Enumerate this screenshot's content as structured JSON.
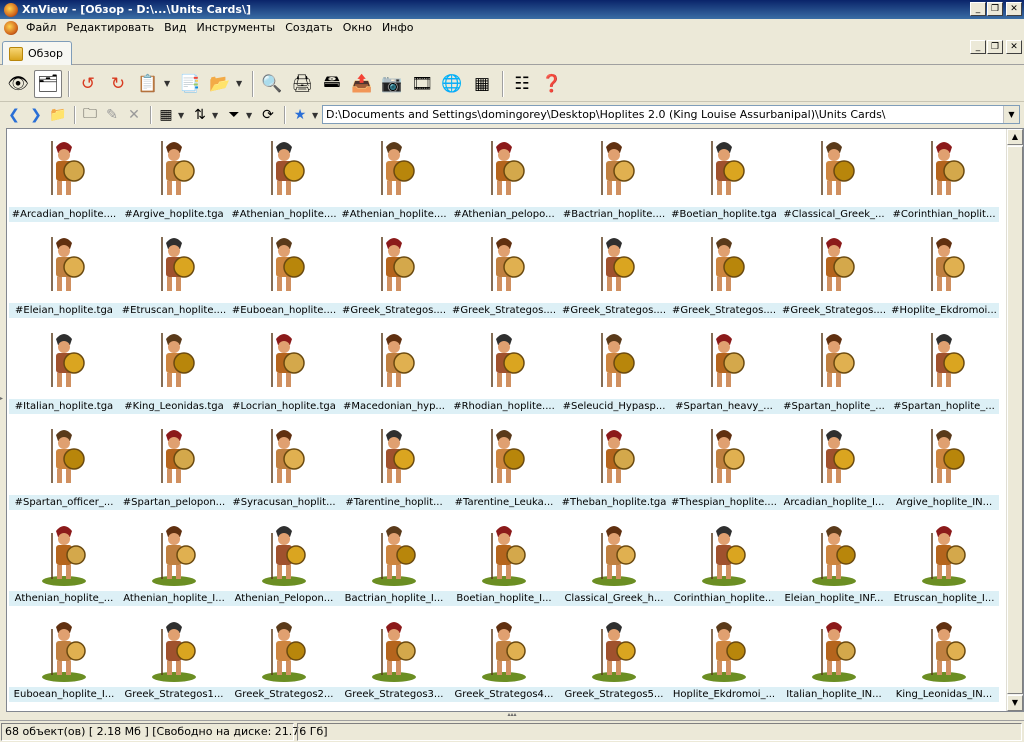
{
  "window": {
    "title": "XnView - [Обзор - D:\\...\\Units Cards\\]",
    "controls": [
      "_",
      "❐",
      "✕"
    ]
  },
  "menu": {
    "items": [
      "Файл",
      "Редактировать",
      "Вид",
      "Инструменты",
      "Создать",
      "Окно",
      "Инфо"
    ]
  },
  "tabs": [
    {
      "label": "Обзор",
      "active": true
    }
  ],
  "toolbar": {
    "icons": [
      "eye-icon",
      "browse-icon",
      "rotate-left-icon",
      "rotate-right-icon",
      "clipboard-icon",
      "checklist-icon",
      "open-folder-icon",
      "image-magnify-icon",
      "printer-icon",
      "scanner-icon",
      "convert-icon",
      "camera-icon",
      "filmstrip-icon",
      "globe-icon",
      "compare-icon",
      "list-icon",
      "help-icon"
    ]
  },
  "address": {
    "path": "D:\\Documents and Settings\\domingorey\\Desktop\\Hoplites 2.0 (King Louise Assurbanipal)\\Units Cards\\"
  },
  "thumbnails": [
    "#Arcadian_hoplite....",
    "#Argive_hoplite.tga",
    "#Athenian_hoplite....",
    "#Athenian_hoplite....",
    "#Athenian_pelopo...",
    "#Bactrian_hoplite....",
    "#Boetian_hoplite.tga",
    "#Classical_Greek_...",
    "#Corinthian_hoplit...",
    "#Eleian_hoplite.tga",
    "#Etruscan_hoplite....",
    "#Euboean_hoplite....",
    "#Greek_Strategos....",
    "#Greek_Strategos....",
    "#Greek_Strategos....",
    "#Greek_Strategos....",
    "#Greek_Strategos....",
    "#Hoplite_Ekdromoi...",
    "#Italian_hoplite.tga",
    "#King_Leonidas.tga",
    "#Locrian_hoplite.tga",
    "#Macedonian_hyp...",
    "#Rhodian_hoplite....",
    "#Seleucid_Hypasp...",
    "#Spartan_heavy_...",
    "#Spartan_hoplite_...",
    "#Spartan_hoplite_...",
    "#Spartan_officer_...",
    "#Spartan_pelopon...",
    "#Syracusan_hoplit...",
    "#Tarentine_hoplit...",
    "#Tarentine_Leuka...",
    "#Theban_hoplite.tga",
    "#Thespian_hoplite....",
    "Arcadian_hoplite_I...",
    "Argive_hoplite_IN...",
    "Athenian_hoplite_...",
    "Athenian_hoplite_I...",
    "Athenian_Pelopon...",
    "Bactrian_hoplite_I...",
    "Boetian_hoplite_I...",
    "Classical_Greek_h...",
    "Corinthian_hoplite...",
    "Eleian_hoplite_INF...",
    "Etruscan_hoplite_I...",
    "Euboean_hoplite_I...",
    "Greek_Strategos1...",
    "Greek_Strategos2...",
    "Greek_Strategos3...",
    "Greek_Strategos4...",
    "Greek_Strategos5...",
    "Hoplite_Ekdromoi_...",
    "Italian_hoplite_IN...",
    "King_Leonidas_IN..."
  ],
  "status": {
    "text": "68 объект(ов) [ 2.18 Мб ] [Свободно на диске: 21.76 Гб]"
  },
  "colors": {
    "label_bg": "#ddf0f6",
    "title_bg": "#0a246a"
  }
}
